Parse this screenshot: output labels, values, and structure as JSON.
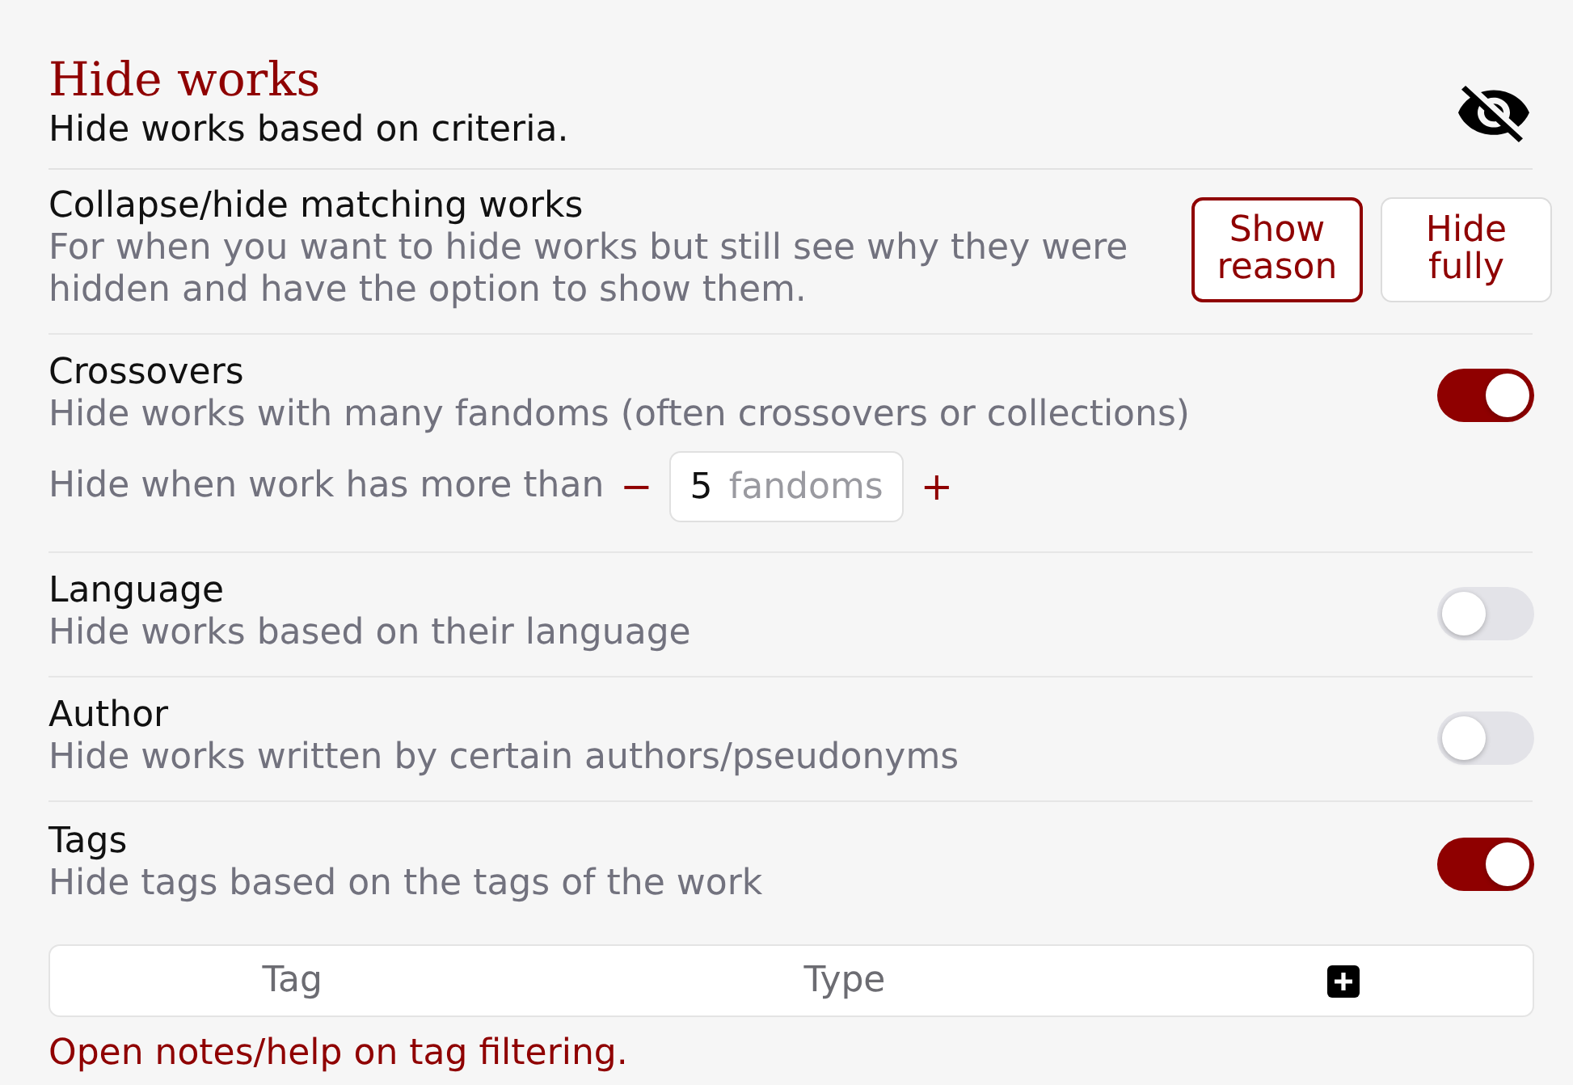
{
  "header": {
    "title": "Hide works",
    "subtitle": "Hide works based on criteria."
  },
  "settings": [
    {
      "kind": "choice",
      "label": "Collapse/hide matching works",
      "description": "For when you want to hide works but still see why they were hidden and have the option to show them.",
      "options": [
        {
          "label": "Show reason",
          "selected": true
        },
        {
          "label": "Hide fully",
          "selected": false
        }
      ]
    },
    {
      "kind": "toggle",
      "label": "Crossovers",
      "description": "Hide works with many fandoms (often crossovers or collections)",
      "on": true,
      "threshold": {
        "prefix": "Hide when work has more than",
        "minus": "−",
        "value": "5",
        "unit": "fandoms",
        "plus": "+"
      }
    },
    {
      "kind": "toggle",
      "label": "Language",
      "description": "Hide works based on their language",
      "on": false
    },
    {
      "kind": "toggle",
      "label": "Author",
      "description": "Hide works written by certain authors/pseudonyms",
      "on": false
    },
    {
      "kind": "toggle",
      "label": "Tags",
      "description": "Hide tags based on the tags of the work",
      "on": true,
      "table": {
        "columns": [
          "Tag",
          "Type"
        ]
      },
      "link": "Open notes/help on tag filtering."
    }
  ]
}
